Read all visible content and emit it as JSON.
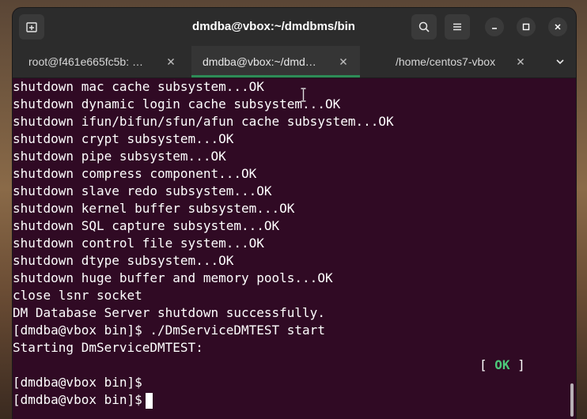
{
  "window": {
    "title": "dmdba@vbox:~/dmdbms/bin"
  },
  "header_buttons": {
    "new_tab_icon": "new-tab-icon",
    "search_icon": "search-icon",
    "menu_icon": "hamburger-menu-icon",
    "minimize_icon": "minimize-icon",
    "maximize_icon": "maximize-icon",
    "close_icon": "close-icon"
  },
  "tabs": [
    {
      "label": "root@f461e665fc5b: …",
      "active": false
    },
    {
      "label": "dmdba@vbox:~/dmd…",
      "active": true
    },
    {
      "label": "/home/centos7-vbox",
      "active": false
    }
  ],
  "colors": {
    "terminal_bg": "#300a24",
    "active_tab_indicator": "#2e8b57",
    "ok_status": "#4cc97a"
  },
  "terminal": {
    "lines": [
      "shutdown mac cache subsystem...OK",
      "shutdown dynamic login cache subsystem...OK",
      "shutdown ifun/bifun/sfun/afun cache subsystem...OK",
      "shutdown crypt subsystem...OK",
      "shutdown pipe subsystem...OK",
      "shutdown compress component...OK",
      "shutdown slave redo subsystem...OK",
      "shutdown kernel buffer subsystem...OK",
      "shutdown SQL capture subsystem...OK",
      "shutdown control file system...OK",
      "shutdown dtype subsystem...OK",
      "shutdown huge buffer and memory pools...OK",
      "close lsnr socket",
      "DM Database Server shutdown successfully.",
      "[dmdba@vbox bin]$ ./DmServiceDMTEST start",
      "Starting DmServiceDMTEST:"
    ],
    "status": {
      "open": "[ ",
      "text": "OK",
      "close": " ]"
    },
    "prompt_1": "[dmdba@vbox bin]$",
    "prompt_2": "[dmdba@vbox bin]$"
  }
}
